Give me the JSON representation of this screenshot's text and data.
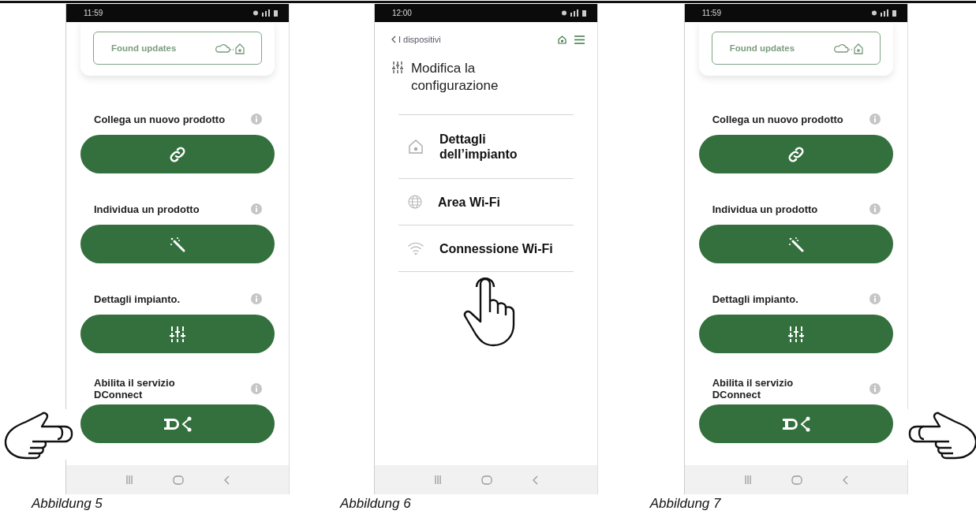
{
  "figures": [
    {
      "kind": "actions",
      "time": "11:59",
      "update_card": {
        "label": "Found updates"
      },
      "actions": [
        {
          "label": "Collega un nuovo prodotto",
          "kind": "link"
        },
        {
          "label": "Individua un prodotto",
          "kind": "wand"
        },
        {
          "label": "Dettagli impianto.",
          "kind": "sliders"
        },
        {
          "label": "Abilita il servizio\nDConnect",
          "kind": "dconnect"
        }
      ],
      "pointer": {
        "kind": "left"
      },
      "caption": "Abbildung 5"
    },
    {
      "kind": "settings",
      "time": "12:00",
      "back_label": "I dispositivi",
      "heading": "Modifica la\nconfigurazione",
      "items": [
        {
          "label": "Dettagli\ndell’impianto",
          "kind": "house"
        },
        {
          "label": "Area Wi-Fi",
          "kind": "globe"
        },
        {
          "label": "Connessione Wi-Fi",
          "kind": "wifi"
        }
      ],
      "pointer": {
        "kind": "tap"
      },
      "caption": "Abbildung 6"
    },
    {
      "kind": "actions",
      "time": "11:59",
      "update_card": {
        "label": "Found updates"
      },
      "actions": [
        {
          "label": "Collega un nuovo prodotto",
          "kind": "link"
        },
        {
          "label": "Individua un prodotto",
          "kind": "wand"
        },
        {
          "label": "Dettagli impianto.",
          "kind": "sliders"
        },
        {
          "label": "Abilita il servizio\nDConnect",
          "kind": "dconnect"
        }
      ],
      "pointer": {
        "kind": "right"
      },
      "caption": "Abbildung 7"
    }
  ]
}
